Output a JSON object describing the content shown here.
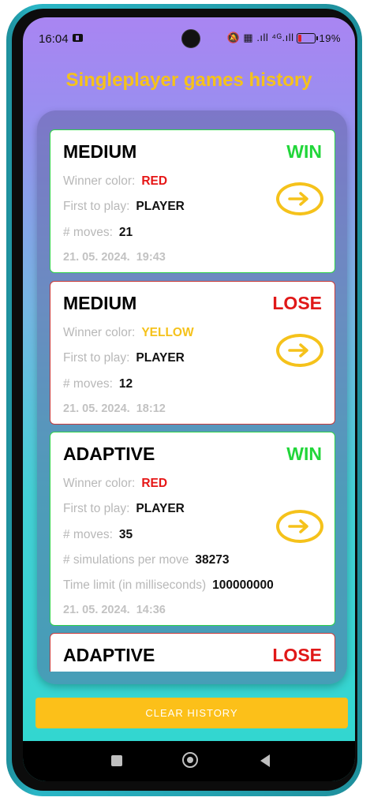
{
  "status_bar": {
    "time": "16:04",
    "signal_text": "‡ ❘❘ .∥∥ ⁴ᴳ.∥∥",
    "battery": "19%"
  },
  "title": "Singleplayer games history",
  "labels": {
    "winner_color": "Winner color:",
    "first_to_play": "First to play:",
    "moves": "# moves:",
    "simulations": "# simulations per move",
    "time_limit": "Time limit (in milliseconds)"
  },
  "games": [
    {
      "mode": "MEDIUM",
      "result": "WIN",
      "winner_color": "RED",
      "first_to_play": "PLAYER",
      "moves": "21",
      "date": "21. 05. 2024.",
      "time": "19:43"
    },
    {
      "mode": "MEDIUM",
      "result": "LOSE",
      "winner_color": "YELLOW",
      "first_to_play": "PLAYER",
      "moves": "12",
      "date": "21. 05. 2024.",
      "time": "18:12"
    },
    {
      "mode": "ADAPTIVE",
      "result": "WIN",
      "winner_color": "RED",
      "first_to_play": "PLAYER",
      "moves": "35",
      "simulations": "38273",
      "time_limit": "100000000",
      "date": "21. 05. 2024.",
      "time": "14:36"
    },
    {
      "mode": "ADAPTIVE",
      "result": "LOSE"
    }
  ],
  "colors": {
    "win": "#22d63a",
    "lose": "#e01818",
    "accent": "#f5c21b"
  },
  "clear_button": "CLEAR HISTORY",
  "icons": [
    "arrow-right-icon",
    "recent-apps-icon",
    "home-icon",
    "back-icon"
  ]
}
